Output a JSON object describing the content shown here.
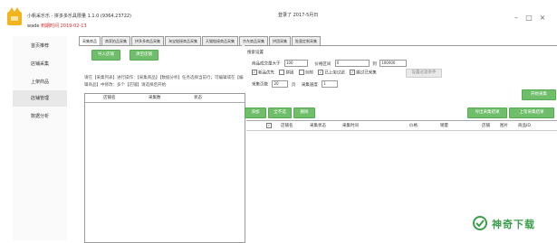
{
  "window": {
    "title": "小帆采乐乐 - 拼多多乐具限量 1.1.0 (9364.23722)",
    "user": "wade",
    "expire_text": "到期时间 2019-02-13",
    "login_time": "登录了 2017-5月日",
    "min_symbol": "–",
    "max_symbol": "□",
    "close_symbol": "×"
  },
  "sidebar": {
    "items": [
      {
        "label": "首页推荐"
      },
      {
        "label": "店铺采集"
      },
      {
        "label": "上架商品"
      },
      {
        "label": "店铺管理"
      },
      {
        "label": "数据分析"
      }
    ],
    "active_index": 3
  },
  "tabs": [
    {
      "label": "采集商品"
    },
    {
      "label": "商家拍品采集"
    },
    {
      "label": "拼多多商品采集"
    },
    {
      "label": "淘宝链接商品采集"
    },
    {
      "label": "天猫链接商品采集"
    },
    {
      "label": "京东商品采集"
    },
    {
      "label": "拼团采集"
    },
    {
      "label": "批量定制采集"
    }
  ],
  "left_panel": {
    "import_button": "导入店铺",
    "clear_button": "清空店铺",
    "hint": "请在【采集列表】进行操作：【采集商品】【数据分析】任务选择当前行，可编辑或在【编辑商品】中修改：多个【店铺】请选择后开始",
    "columns": [
      "店铺名",
      "采集数",
      "状态"
    ]
  },
  "right_panel": {
    "section_title": "搜索设置",
    "min_sales_label": "商品成交量大于",
    "min_sales_value": "100",
    "price_label": "价格区间",
    "price_min": "0",
    "price_to": "到",
    "price_max": "100000",
    "checkbox1": "新品优先",
    "checkbox2": "拼团",
    "checkbox3": "包邮",
    "checkbox4": "已上架过滤",
    "checkbox5": "跳过已采集",
    "disabled_button": "设置过滤条件",
    "page_label": "采集页数",
    "page_value": "20",
    "page_unit": "页",
    "speed_label": "采集速度",
    "speed_value": "1",
    "start_button": "开始采集",
    "btn_add": "添加",
    "btn_select_all": "全不选",
    "btn_delete": "删除",
    "btn_export": "导出采集结果",
    "btn_bulk": "上架采集结果",
    "columns": [
      "店铺名",
      "采集状态",
      "采集时间",
      "价格",
      "销量",
      "店铺",
      "图片",
      "商品ID"
    ]
  },
  "watermark": {
    "text": "神奇下载"
  },
  "colors": {
    "accent_green": "#6fbe6a",
    "expire_red": "#d32b2b",
    "logo_yellow": "#f2b41c"
  }
}
